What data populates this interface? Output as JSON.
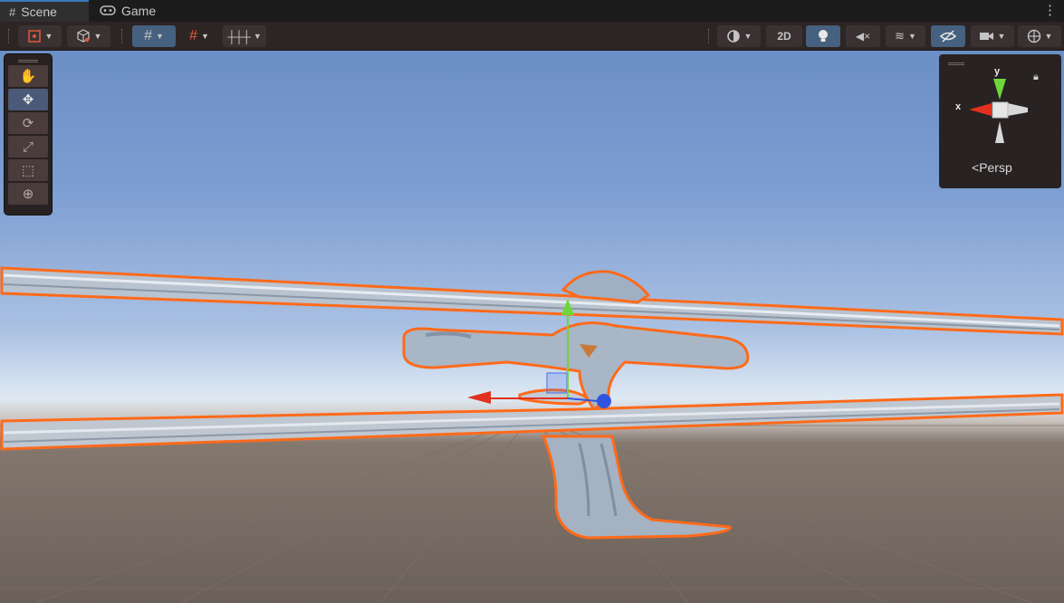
{
  "tabs": [
    {
      "label": "Scene",
      "icon": "scene-grid-icon",
      "active": true
    },
    {
      "label": "Game",
      "icon": "gamepad-icon",
      "active": false
    }
  ],
  "toolbar": {
    "toggle_2d_label": "2D"
  },
  "tools": [
    "hand-tool",
    "move-tool",
    "rotate-tool",
    "scale-tool",
    "rect-tool",
    "transform-tool"
  ],
  "selected_tool": "move-tool",
  "orientation_gizmo": {
    "y_label": "y",
    "x_label": "x",
    "projection_label": "Persp"
  },
  "colors": {
    "selection_outline": "#ff6a1a",
    "x_axis": "#e0301e",
    "y_axis": "#6fd63a",
    "z_axis": "#2f55e0",
    "active_toggle": "#46607f"
  }
}
